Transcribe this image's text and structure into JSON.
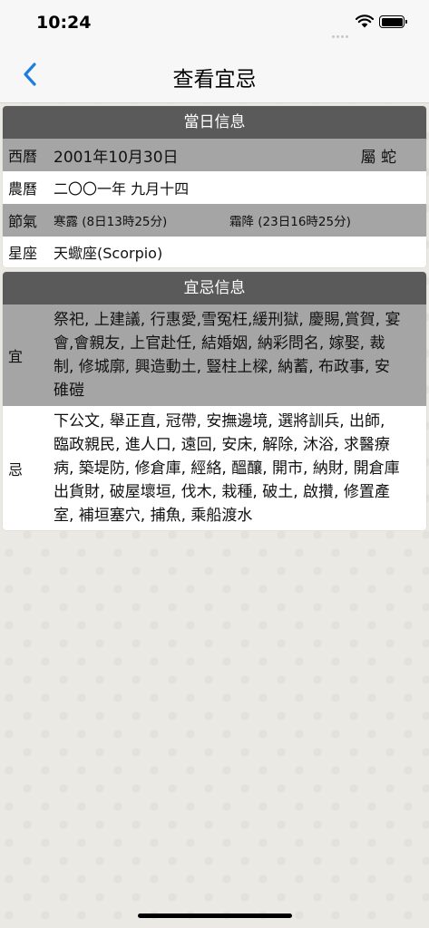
{
  "status": {
    "time": "10:24"
  },
  "nav": {
    "title": "查看宜忌"
  },
  "day_info": {
    "header": "當日信息",
    "western": {
      "label": "西曆",
      "date": "2001年10月30日",
      "zodiac": "屬 蛇"
    },
    "lunar": {
      "label": "農曆",
      "date": "二〇〇一年 九月十四"
    },
    "solar_term": {
      "label": "節氣",
      "term1": "寒露 (8日13時25分)",
      "term2": "霜降 (23日16時25分)"
    },
    "constellation": {
      "label": "星座",
      "value": "天蠍座(Scorpio)"
    }
  },
  "yiji": {
    "header": "宜忌信息",
    "yi": {
      "label": "宜",
      "lines": [
        "祭祀, 上建議, 行惠愛,雪冤枉,緩刑獄, 慶賜,賞賀, 宴",
        "會,會親友, 上官赴任, 結婚姻, 納彩問名, 嫁娶, 裁",
        "制, 修城廓, 興造動土, 豎柱上樑, 納蓄, 布政事, 安",
        "碓磑"
      ]
    },
    "ji": {
      "label": "忌",
      "lines": [
        "下公文, 舉正直, 冠帶, 安撫邊境, 選將訓兵, 出師,",
        "臨政親民, 進人口, 遠回, 安床, 解除, 沐浴, 求醫療",
        "病, 築堤防, 修倉庫, 經絡, 醞釀, 開市, 納財, 開倉庫",
        "出貨財, 破屋壞垣, 伐木, 栽種, 破土, 啟攢, 修置產",
        "室, 補垣塞穴, 捕魚, 乘船渡水"
      ]
    }
  },
  "colors": {
    "accent": "#1a7fe0",
    "header_bg": "#5a5a5a",
    "row_gray": "#a5a5a5"
  },
  "icons": {
    "back": "chevron-left-icon",
    "wifi": "wifi-icon",
    "battery": "battery-icon"
  }
}
